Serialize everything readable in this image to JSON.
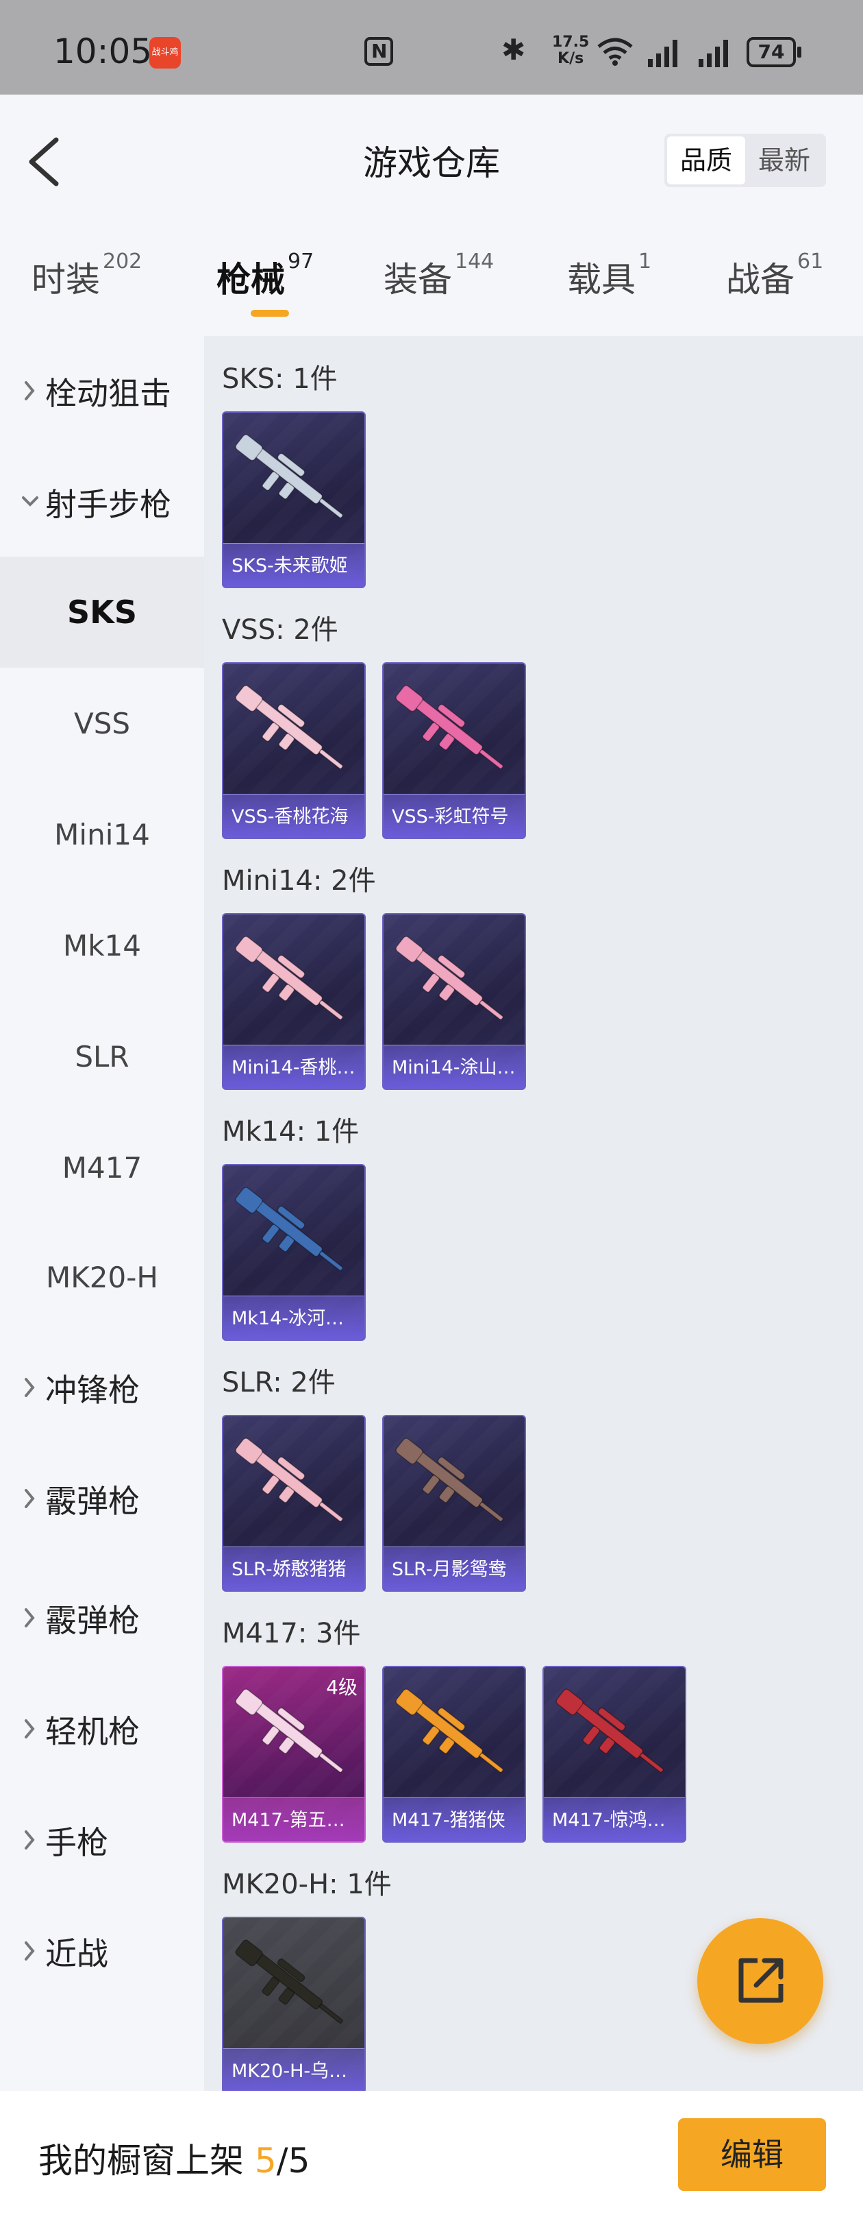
{
  "status_bar": {
    "time": "10:05",
    "app_icon_label": "战斗鸡",
    "net_speed_value": "17.5",
    "net_speed_unit": "K/s",
    "battery": "74"
  },
  "header": {
    "title": "游戏仓库",
    "sort_options": [
      "品质",
      "最新"
    ],
    "active_sort": "品质"
  },
  "tabs": [
    {
      "label": "时装",
      "count": "202"
    },
    {
      "label": "枪械",
      "count": "97"
    },
    {
      "label": "装备",
      "count": "144"
    },
    {
      "label": "载具",
      "count": "1"
    },
    {
      "label": "战备",
      "count": "61"
    }
  ],
  "active_tab": "枪械",
  "sidebar": {
    "items": [
      {
        "label": "栓动狙击",
        "type": "group",
        "expanded": false
      },
      {
        "label": "射手步枪",
        "type": "group",
        "expanded": true
      },
      {
        "label": "SKS",
        "type": "sub",
        "active": true
      },
      {
        "label": "VSS",
        "type": "sub"
      },
      {
        "label": "Mini14",
        "type": "sub"
      },
      {
        "label": "Mk14",
        "type": "sub"
      },
      {
        "label": "SLR",
        "type": "sub"
      },
      {
        "label": "M417",
        "type": "sub"
      },
      {
        "label": "MK20-H",
        "type": "sub"
      },
      {
        "label": "冲锋枪",
        "type": "group",
        "expanded": false
      },
      {
        "label": "霰弹枪",
        "type": "group",
        "expanded": false
      },
      {
        "label": "霰弹枪",
        "type": "group",
        "expanded": false
      },
      {
        "label": "轻机枪",
        "type": "group",
        "expanded": false
      },
      {
        "label": "手枪",
        "type": "group",
        "expanded": false
      },
      {
        "label": "近战",
        "type": "group",
        "expanded": false
      }
    ]
  },
  "sections": [
    {
      "title": "SKS: 1件",
      "items": [
        {
          "name": "SKS-未来歌姬",
          "gun_color": "#c9d3e0"
        }
      ]
    },
    {
      "title": "VSS: 2件",
      "items": [
        {
          "name": "VSS-香桃花海",
          "gun_color": "#f3c6d4"
        },
        {
          "name": "VSS-彩虹符号",
          "gun_color": "#e86aa6"
        }
      ]
    },
    {
      "title": "Mini14: 2件",
      "items": [
        {
          "name": "Mini14-香桃…",
          "gun_color": "#f2b9c9"
        },
        {
          "name": "Mini14-涂山…",
          "gun_color": "#f0a8c0"
        }
      ]
    },
    {
      "title": "Mk14: 1件",
      "items": [
        {
          "name": "Mk14-冰河…",
          "gun_color": "#3e6fb5"
        }
      ]
    },
    {
      "title": "SLR: 2件",
      "items": [
        {
          "name": "SLR-娇憨猪猪",
          "gun_color": "#f1b8c6"
        },
        {
          "name": "SLR-月影鸳鸯",
          "gun_color": "#8a6a60"
        }
      ]
    },
    {
      "title": "M417: 3件",
      "items": [
        {
          "name": "M417-第五…",
          "gun_color": "#f4d6e6",
          "level": "4级"
        },
        {
          "name": "M417-猪猪侠",
          "gun_color": "#f09a2a"
        },
        {
          "name": "M417-惊鸿…",
          "gun_color": "#c0303a"
        }
      ]
    },
    {
      "title": "MK20-H: 1件",
      "items": [
        {
          "name": "MK20-H-乌…",
          "gun_color": "#2a2a22"
        }
      ]
    }
  ],
  "bottom_bar": {
    "label": "我的橱窗上架",
    "current": "5",
    "separator": "/",
    "total": "5",
    "edit_label": "编辑"
  }
}
